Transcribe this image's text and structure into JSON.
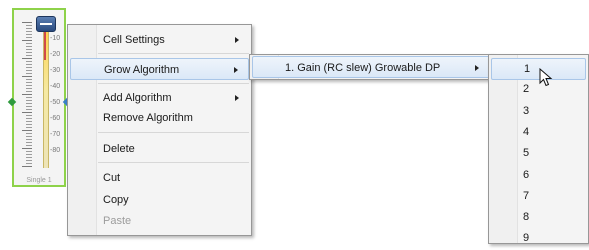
{
  "cell": {
    "label": "Single 1",
    "scale": [
      "0",
      "-10",
      "-20",
      "-30",
      "-40",
      "-50",
      "-60",
      "-70",
      "-80"
    ],
    "colors": {
      "border": "#8ed24a",
      "knob": "#2a4a7e",
      "left_port": "#2f9a3e",
      "right_port": "#3a7fc9"
    }
  },
  "context_menu": {
    "items": [
      {
        "label": "Cell Settings",
        "submenu": true
      },
      {
        "label": "Grow Algorithm",
        "submenu": true,
        "highlighted": true
      },
      {
        "label": "Add Algorithm",
        "submenu": true
      },
      {
        "label": "Remove Algorithm",
        "submenu": false
      },
      {
        "label": "Delete",
        "submenu": false
      },
      {
        "label": "Cut",
        "submenu": false
      },
      {
        "label": "Copy",
        "submenu": false
      },
      {
        "label": "Paste",
        "submenu": false,
        "disabled": true
      }
    ]
  },
  "grow_submenu": {
    "items": [
      {
        "label": "1. Gain (RC slew) Growable DP",
        "submenu": true,
        "highlighted": true
      }
    ]
  },
  "count_submenu": {
    "items": [
      "1",
      "2",
      "3",
      "4",
      "5",
      "6",
      "7",
      "8",
      "9"
    ],
    "highlighted_index": 0
  },
  "cursor_icon": "arrow-pointer-icon"
}
